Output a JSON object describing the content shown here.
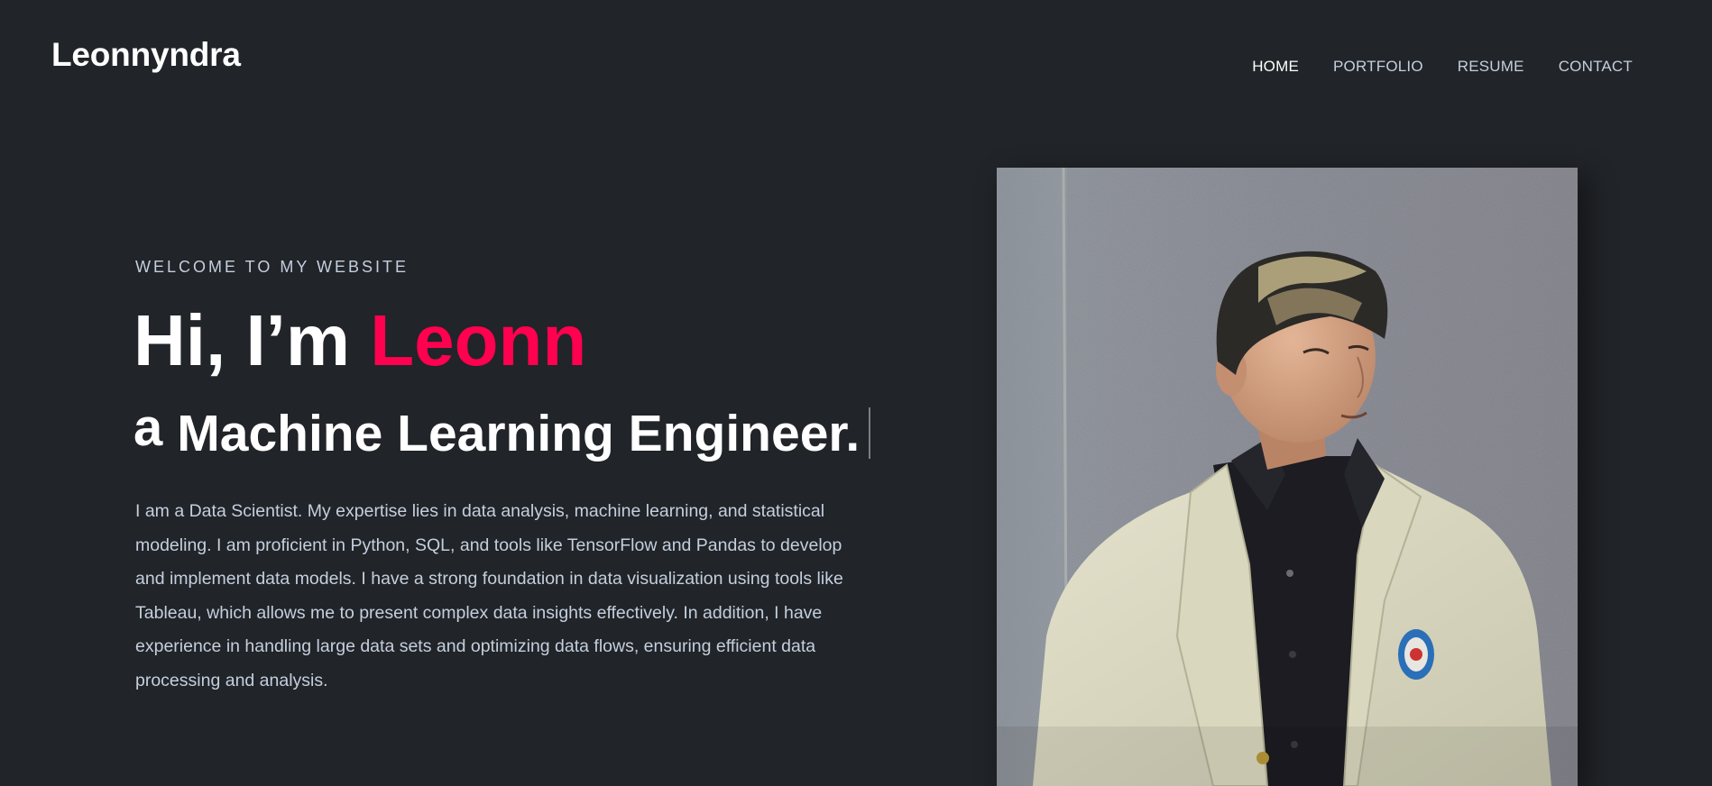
{
  "header": {
    "logo": "Leonnyndra",
    "nav": [
      {
        "label": "HOME",
        "active": true
      },
      {
        "label": "PORTFOLIO",
        "active": false
      },
      {
        "label": "RESUME",
        "active": false
      },
      {
        "label": "CONTACT",
        "active": false
      }
    ]
  },
  "hero": {
    "eyebrow": "WELCOME TO MY WEBSITE",
    "greeting": "Hi, I’m ",
    "name": "Leonn",
    "role_prefix": "a",
    "role": "Machine Learning Engineer.",
    "bio": "I am a Data Scientist. My expertise lies in data analysis, machine learning, and statistical modeling. I am proficient in Python, SQL, and tools like TensorFlow and Pandas to develop and implement data models. I have a strong foundation in data visualization using tools like Tableau, which allows me to present complex data insights effectively. In addition, I have experience in handling large data sets and optimizing data flows, ensuring efficient data processing and analysis."
  },
  "colors": {
    "background": "#212428",
    "accent": "#ff014f",
    "text_muted": "#c4cfde"
  }
}
